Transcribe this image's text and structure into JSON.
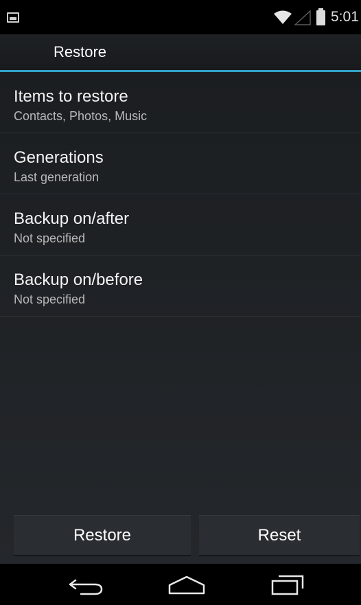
{
  "status_bar": {
    "notification_icon": "picture-icon",
    "wifi_icon": "wifi-icon",
    "signal_icon": "signal-icon",
    "battery_icon": "battery-icon",
    "time": "5:01"
  },
  "action_bar": {
    "title": "Restore",
    "accent_color": "#33a2c8"
  },
  "preferences": [
    {
      "title": "Items to restore",
      "summary": "Contacts, Photos, Music"
    },
    {
      "title": "Generations",
      "summary": "Last generation"
    },
    {
      "title": "Backup on/after",
      "summary": "Not specified"
    },
    {
      "title": "Backup on/before",
      "summary": "Not specified"
    }
  ],
  "buttons": {
    "restore": "Restore",
    "reset": "Reset"
  },
  "nav_bar": {
    "back_icon": "back-icon",
    "home_icon": "home-icon",
    "recents_icon": "recents-icon"
  }
}
